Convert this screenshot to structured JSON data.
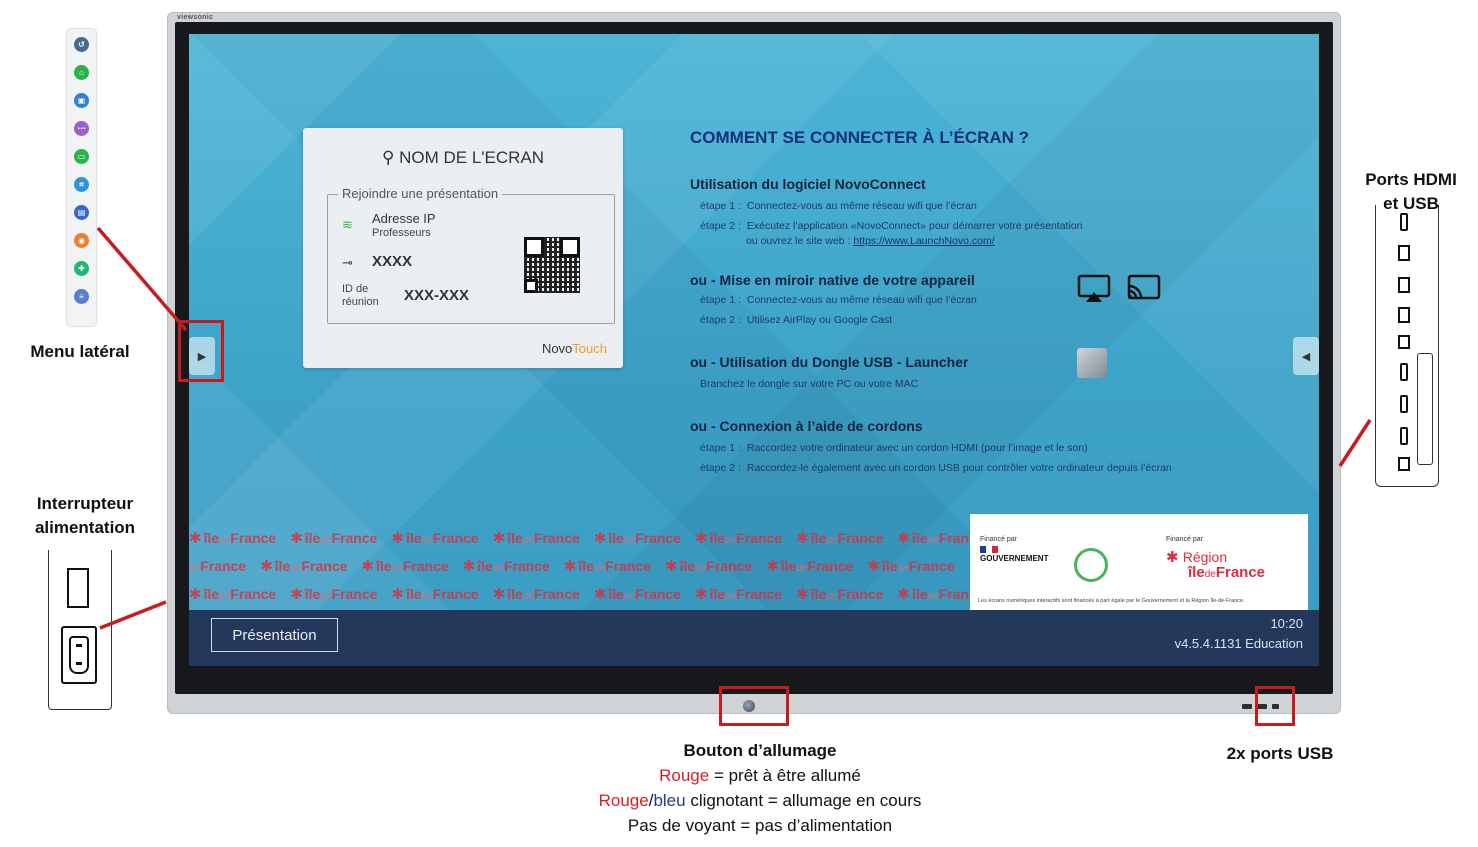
{
  "monitor": {
    "brand": "viewsonic"
  },
  "card": {
    "title": "NOM DE L'ECRAN",
    "legend": "Rejoindre une présentation",
    "ip_label": "Adresse IP",
    "network": "Professeurs",
    "key_value": "XXXX",
    "meeting_label_1": "ID de",
    "meeting_label_2": "réunion",
    "meeting_id": "XXX-XXX",
    "brand_a": "Novo",
    "brand_b": "Touch"
  },
  "instructions": {
    "title": "COMMENT SE CONNECTER À L’ÉCRAN ?",
    "sec1_title": "Utilisation du logiciel NovoConnect",
    "sec1_step1_label": "étape 1 :",
    "sec1_step1": "Connectez-vous au même réseau wifi que l’écran",
    "sec1_step2_label": "étape 2 :",
    "sec1_step2": "Exécutez l’application «NovoConnect» pour démarrer votre présentation",
    "sec1_step2b": "ou ouvrez le site web :",
    "sec1_link": "https://www.LaunchNovo.com/",
    "sec2_title": "ou - Mise en miroir native de votre appareil",
    "sec2_step1_label": "étape 1 :",
    "sec2_step1": "Connectez-vous au même réseau wifi que l’écran",
    "sec2_step2_label": "étape 2 :",
    "sec2_step2": "Utilisez AirPlay ou Google Cast",
    "sec3_title": "ou - Utilisation du Dongle USB - Launcher",
    "sec3_text": "Branchez le dongle sur votre PC ou votre MAC",
    "sec4_title": "ou - Connexion à l’aide de cordons",
    "sec4_step1_label": "étape 1 :",
    "sec4_step1": "Raccordez votre ordinateur avec un cordon HDMI (pour l’image et le son)",
    "sec4_step2_label": "étape 2 :",
    "sec4_step2": "Raccordez-le également avec un cordon USB pour contrôler votre ordinateur depuis l’écran"
  },
  "funding": {
    "label_left": "Financé par",
    "label_right": "Financé par",
    "gouv": "GOUVERNEMENT",
    "region_1": "Région",
    "region_2a": "île",
    "region_2b": "de",
    "region_2c": "France",
    "footer": "Les écrans numériques interactifs sont financés à part égale par le Gouvernement et la Région Île-de-France."
  },
  "bottom_bar": {
    "presentation": "Présentation",
    "clock": "10:20",
    "version": "v4.5.4.1131 Education"
  },
  "labels": {
    "menu_lateral": "Menu latéral",
    "interrupteur_1": "Interrupteur",
    "interrupteur_2": "alimentation",
    "ports_1": "Ports HDMI",
    "ports_2": "et USB",
    "usb": "2x ports USB"
  },
  "caption": {
    "title": "Bouton d’allumage",
    "line1_red": "Rouge",
    "line1_rest": " = prêt à être allumé",
    "line2_red": "Rouge",
    "line2_slash": "/",
    "line2_blue": "bleu",
    "line2_rest": " clignotant = allumage en cours",
    "line3": "Pas de voyant = pas d’alimentation"
  },
  "colors": {
    "callout_red": "#c51d1d",
    "screen_blue": "#3ea3c9",
    "bar_navy": "#24385c",
    "region_red": "#e12b3a"
  },
  "side_menu_icons": [
    {
      "icon": "back-icon",
      "color": "#4a6a8c"
    },
    {
      "icon": "home-icon",
      "color": "#2db24a"
    },
    {
      "icon": "window-icon",
      "color": "#2f7fd8"
    },
    {
      "icon": "apps-icon",
      "color": "#9a5fd1"
    },
    {
      "icon": "whiteboard-icon",
      "color": "#2db24a"
    },
    {
      "icon": "crop-icon",
      "color": "#2f95d8"
    },
    {
      "icon": "screen-share-icon",
      "color": "#3a66c9"
    },
    {
      "icon": "record-icon",
      "color": "#ef7d2f"
    },
    {
      "icon": "tools-icon",
      "color": "#22b573"
    },
    {
      "icon": "settings-icon",
      "color": "#5a7fcf"
    }
  ]
}
